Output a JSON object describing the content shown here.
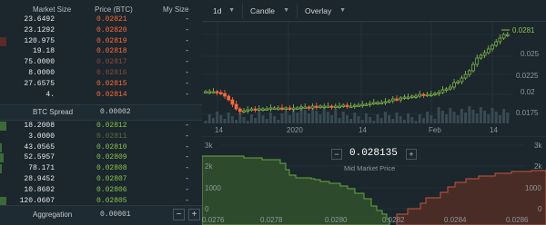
{
  "orderbook": {
    "headers": {
      "size": "Market Size",
      "price": "Price (BTC)",
      "my": "My Size"
    },
    "asks": [
      {
        "size": "23.6492",
        "price": "0.02821",
        "my": "-",
        "bar": 0.0,
        "dim": false
      },
      {
        "size": "23.1292",
        "price": "0.02820",
        "my": "-",
        "bar": 0.0,
        "dim": false
      },
      {
        "size": "120.975",
        "price": "0.02819",
        "my": "-",
        "bar": 0.03,
        "dim": false
      },
      {
        "size": "19.18",
        "price": "0.02818",
        "my": "-",
        "bar": 0.0,
        "dim": false
      },
      {
        "size": "75.0000",
        "price": "0.02817",
        "my": "-",
        "bar": 0.0,
        "dim": true
      },
      {
        "size": "8.0000",
        "price": "0.02816",
        "my": "-",
        "bar": 0.0,
        "dim": true
      },
      {
        "size": "27.6575",
        "price": "0.02815",
        "my": "-",
        "bar": 0.0,
        "dim": false
      },
      {
        "size": "4.",
        "price": "0.02814",
        "my": "-",
        "bar": 0.0,
        "dim": false
      }
    ],
    "spread": {
      "label": "BTC Spread",
      "value": "0.00002"
    },
    "bids": [
      {
        "size": "18.2008",
        "price": "0.02812",
        "my": "-",
        "bar": 0.03,
        "dim": false
      },
      {
        "size": "3.0000",
        "price": "0.02811",
        "my": "-",
        "bar": 0.0,
        "dim": true
      },
      {
        "size": "43.0565",
        "price": "0.02810",
        "my": "-",
        "bar": 0.01,
        "dim": false
      },
      {
        "size": "52.5957",
        "price": "0.02809",
        "my": "-",
        "bar": 0.02,
        "dim": false
      },
      {
        "size": "78.171",
        "price": "0.02808",
        "my": "-",
        "bar": 0.01,
        "dim": false
      },
      {
        "size": "28.9452",
        "price": "0.02807",
        "my": "-",
        "bar": 0.0,
        "dim": false
      },
      {
        "size": "10.8602",
        "price": "0.02806",
        "my": "-",
        "bar": 0.0,
        "dim": false
      },
      {
        "size": "120.0607",
        "price": "0.02805",
        "my": "-",
        "bar": 0.03,
        "dim": false
      }
    ],
    "aggregation": {
      "label": "Aggregation",
      "value": "0.00001",
      "minus": "−",
      "plus": "+"
    }
  },
  "toolbar": {
    "interval": "1d",
    "chart_type": "Candle",
    "overlay": "Overlay"
  },
  "candle_chart": {
    "y_ticks": [
      "0.025",
      "0.0225",
      "0.02",
      "0.0175"
    ],
    "last_price": "0.0281",
    "x_ticks": [
      "14",
      "2020",
      "14",
      "Feb",
      "14"
    ]
  },
  "depth_chart": {
    "y_ticks": [
      "3k",
      "2k",
      "1000",
      "0"
    ],
    "y_ticks_right": [
      "3k",
      "2k",
      "1000",
      "0"
    ],
    "x_ticks": [
      "0.0276",
      "0.0278",
      "0.0280",
      "0.0282",
      "0.0284",
      "0.0286"
    ],
    "mid_price": "0.028135",
    "mid_label": "Mid Market Price",
    "minus": "−",
    "plus": "+"
  },
  "colors": {
    "ask": "#ff6939",
    "bid": "#8bc34a",
    "bg": "#1b262d"
  }
}
